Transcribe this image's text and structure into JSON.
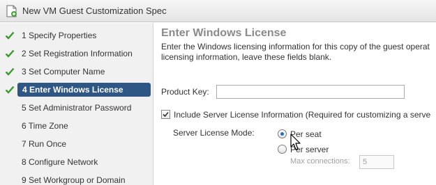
{
  "window": {
    "title": "New VM Guest Customization Spec"
  },
  "sidebar": {
    "steps": [
      {
        "label": "1  Specify Properties",
        "completed": true
      },
      {
        "label": "2  Set Registration Information",
        "completed": true
      },
      {
        "label": "3  Set Computer Name",
        "completed": true
      },
      {
        "label": "4  Enter Windows License",
        "completed": true,
        "current": true
      },
      {
        "label": "5  Set Administrator Password",
        "completed": false
      },
      {
        "label": "6  Time Zone",
        "completed": false
      },
      {
        "label": "7  Run Once",
        "completed": false
      },
      {
        "label": "8  Configure Network",
        "completed": false
      },
      {
        "label": "9  Set Workgroup or Domain",
        "completed": false
      }
    ]
  },
  "main": {
    "heading": "Enter Windows License",
    "description_line1": "Enter the Windows licensing information for this copy of the guest operat",
    "description_line2": "licensing information, leave these fields blank.",
    "product_key_label": "Product Key:",
    "product_key_value": "",
    "include_server_label": "Include Server License Information (Required for customizing a serve",
    "include_server_checked": true,
    "server_license_mode_label": "Server License Mode:",
    "per_seat_label": "Per seat",
    "per_server_label": "Per server",
    "selected_mode": "Per seat",
    "max_connections_label": "Max connections:",
    "max_connections_value": "5"
  },
  "colors": {
    "accent": "#2f5785",
    "check": "#3a9a2a",
    "heading": "#8a8a8a"
  },
  "icons": {
    "title": "document-add-icon",
    "step_done": "checkmark-icon",
    "pointer": "mouse-cursor-icon"
  }
}
